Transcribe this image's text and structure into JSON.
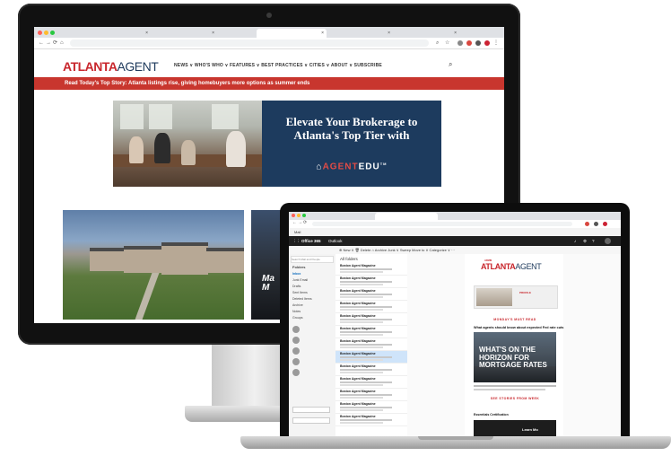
{
  "desktop": {
    "browser": {
      "tab_close": "×"
    },
    "site": {
      "logo_primary": "ATLANTA",
      "logo_secondary": "AGENT",
      "nav_text": "NEWS ∨  WHO'S WHO ∨  FEATURES ∨  BEST PRACTICES ∨  CITIES ∨  ABOUT ∨  SUBSCRIBE",
      "top_story": "Read Today's Top Story: Atlanta listings rise, giving homebuyers more options as summer ends",
      "search_icon": "search-icon",
      "ad": {
        "headline_line1": "Elevate Your Brokerage to",
        "headline_line2": "Atlanta's Top Tier with",
        "brand_main": "AGENT",
        "brand_suffix": "EDU",
        "brand_mark": "TM"
      },
      "article2_partial": "Ma\nM"
    }
  },
  "laptop": {
    "search_tab": "Mail",
    "office_bar": {
      "product": "Office 365",
      "app": "Outlook"
    },
    "toolbar": "⊕ New ∨   🗑 Delete   ⌂ Archive   Junk ∨   Sweep   Move to ∨   Categorize ∨   ···",
    "folder_pane": {
      "search_placeholder": "Search Mail and People",
      "heading": "Folders",
      "items": [
        "Inbox",
        "Junk Email",
        "Drafts",
        "Sent Items",
        "Deleted Items",
        "Archive",
        "Notes",
        "Groups"
      ]
    },
    "message_list": {
      "heading": "All folders",
      "sender": "Boston Agent Magazine",
      "rows": 12
    },
    "newsletter": {
      "tiny_label": "ADMIN",
      "logo_primary": "ATLANTA",
      "logo_secondary": "AGENT",
      "ad_label": "PROFILE",
      "section_label": "MONDAY'S MUST READ",
      "headline": "What agents should know about expected Fed rate cuts",
      "hero_line1": "WHAT'S ON THE",
      "hero_line2": "HORIZON FOR",
      "hero_line3": "MORTGAGE RATES",
      "cta": "SEE STORIES FROM WEEK",
      "cert_heading": "Essentials Certification",
      "cert_card": "Learn Mo"
    }
  }
}
